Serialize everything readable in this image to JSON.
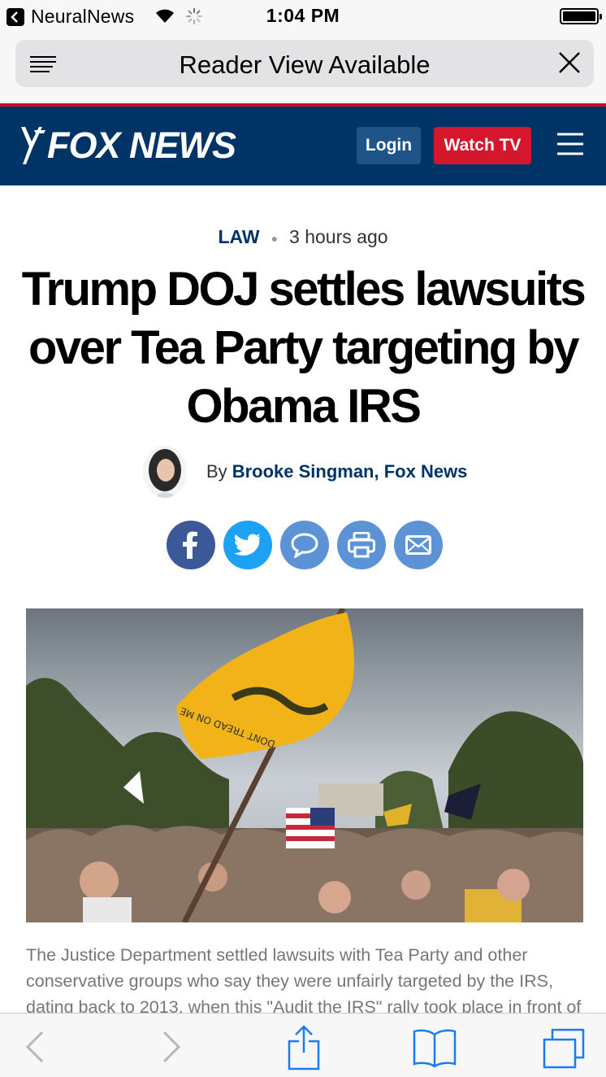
{
  "status_bar": {
    "back_app": "NeuralNews",
    "time": "1:04 PM"
  },
  "browser": {
    "reader_text": "Reader View Available",
    "load_progress": 0.235
  },
  "header": {
    "brand": "FOX NEWS",
    "login_label": "Login",
    "watch_label": "Watch TV",
    "colors": {
      "navy": "#003366",
      "red": "#d4172c",
      "login": "#1f5489"
    }
  },
  "article": {
    "category": "LAW",
    "time_ago": "3 hours ago",
    "headline": "Trump DOJ settles lawsuits over Tea Party targeting by Obama IRS",
    "byline_prefix": "By",
    "author": "Brooke Singman, Fox News",
    "share_icons": [
      "facebook-icon",
      "twitter-icon",
      "comment-icon",
      "print-icon",
      "email-icon"
    ],
    "image_flag_text": "DONT TREAD ON ME",
    "caption": "The Justice Department settled lawsuits with Tea Party and other conservative groups who say they were unfairly targeted by the IRS, dating back to 2013, when this \"Audit the IRS\" rally took place in front of"
  },
  "toolbar": {
    "icons": [
      "back-icon",
      "forward-icon",
      "share-icon",
      "bookmarks-icon",
      "tabs-icon"
    ]
  }
}
